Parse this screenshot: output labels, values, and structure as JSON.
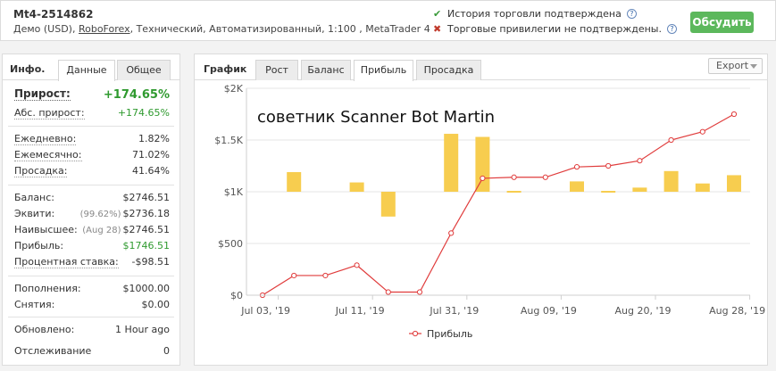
{
  "header": {
    "account_title": "Mt4-2514862",
    "account_sub_prefix": "Демо (USD), ",
    "broker_link": "RoboForex",
    "account_sub_suffix": ", Технический, Автоматизированный, 1:100 , MetaTrader 4",
    "history_verified": "История торговли подтверждена",
    "privileges_not_verified": "Торговые привилегии не подтверждены.",
    "help_glyph": "?",
    "check_glyph": "✔",
    "cross_glyph": "✖",
    "discuss_button": "Обсудить",
    "colors": {
      "check": "#3a9a3a",
      "cross": "#c0392b",
      "discuss_bg": "#5cb85c"
    }
  },
  "left_panel": {
    "tabs": {
      "info": "Инфо.",
      "data": "Данные",
      "general": "Общее"
    },
    "active_tab": "Данные",
    "gain": {
      "label": "Прирост:",
      "value": "+174.65%"
    },
    "abs_gain": {
      "label": "Абс. прирост:",
      "value": "+174.65%"
    },
    "daily": {
      "label": "Ежедневно:",
      "value": "1.82%"
    },
    "monthly": {
      "label": "Ежемесячно:",
      "value": "71.02%"
    },
    "drawdown": {
      "label": "Просадка:",
      "value": "41.64%"
    },
    "balance": {
      "label": "Баланс:",
      "value": "$2746.51"
    },
    "equity": {
      "label": "Эквити:",
      "sub": "(99.62%)",
      "value": "$2736.18"
    },
    "highest": {
      "label": "Наивысшее:",
      "sub": "(Aug 28)",
      "value": "$2746.51"
    },
    "profit": {
      "label": "Прибыль:",
      "value": "$1746.51"
    },
    "interest": {
      "label": "Процентная ставка:",
      "value": "-$98.51"
    },
    "deposits": {
      "label": "Пополнения:",
      "value": "$1000.00"
    },
    "withdrawals": {
      "label": "Снятия:",
      "value": "$0.00"
    },
    "updated": {
      "label": "Обновлено:",
      "value": "1 Hour ago"
    },
    "tracking": {
      "label": "Отслеживание",
      "value": "0"
    }
  },
  "right_panel": {
    "tabs": {
      "chart": "График",
      "growth": "Рост",
      "balance": "Баланс",
      "profit": "Прибыль",
      "drawdown": "Просадка"
    },
    "active_tab": "Прибыль",
    "export_label": "Export",
    "overlay_text": "советник Scanner Bot Martin"
  },
  "chart_data": {
    "type": "line",
    "title": "",
    "xlabel": "",
    "ylabel": "",
    "ylim": [
      0,
      2000
    ],
    "y_ticks": [
      "$0",
      "$500",
      "$1K",
      "$1.5K",
      "$2K"
    ],
    "y_tick_values": [
      0,
      500,
      1000,
      1500,
      2000
    ],
    "x_tick_labels": [
      "Jul 03, '19",
      "Jul 11, '19",
      "Jul 31, '19",
      "Aug 09, '19",
      "Aug 20, '19",
      "Aug 28, '19"
    ],
    "x_tick_indices": [
      0,
      3,
      6,
      9,
      12,
      15
    ],
    "grid": "horizontal",
    "legend": "bottom-center",
    "series": [
      {
        "name": "Прибыль",
        "kind": "line",
        "color": "#e03c3c",
        "values": [
          0,
          190,
          190,
          290,
          30,
          30,
          600,
          1130,
          1140,
          1140,
          1240,
          1250,
          1300,
          1500,
          1580,
          1750
        ]
      },
      {
        "kind": "bar",
        "color": "#f7cd4f",
        "values": [
          0,
          190,
          0,
          90,
          -240,
          0,
          560,
          530,
          10,
          0,
          100,
          10,
          40,
          200,
          80,
          160
        ]
      }
    ]
  }
}
